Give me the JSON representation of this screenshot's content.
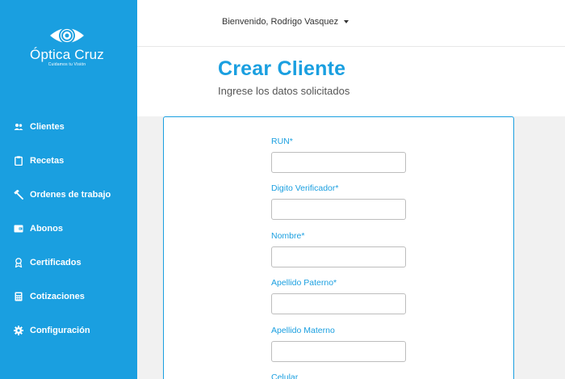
{
  "brand": {
    "name": "Óptica Cruz",
    "tagline": "Cuidamos tu Visión"
  },
  "sidebar": {
    "items": [
      {
        "label": "Clientes",
        "icon": "users-icon"
      },
      {
        "label": "Recetas",
        "icon": "clipboard-icon"
      },
      {
        "label": "Ordenes de trabajo",
        "icon": "hammer-icon"
      },
      {
        "label": "Abonos",
        "icon": "wallet-icon"
      },
      {
        "label": "Certificados",
        "icon": "award-icon"
      },
      {
        "label": "Cotizaciones",
        "icon": "calculator-icon"
      },
      {
        "label": "Configuración",
        "icon": "gear-icon"
      }
    ]
  },
  "topbar": {
    "user_greeting": "Bienvenido, Rodrigo Vasquez"
  },
  "page": {
    "title": "Crear Cliente",
    "subtitle": "Ingrese los datos solicitados"
  },
  "form": {
    "fields": [
      {
        "label": "RUN*",
        "value": ""
      },
      {
        "label": "Digito Verificador*",
        "value": ""
      },
      {
        "label": "Nombre*",
        "value": ""
      },
      {
        "label": "Apellido Paterno*",
        "value": ""
      },
      {
        "label": "Apellido Materno",
        "value": ""
      },
      {
        "label": "Celular",
        "value": ""
      }
    ]
  },
  "colors": {
    "accent": "#1a9fe0",
    "sidebar_bg": "#1a9fe0",
    "page_bg": "#f1f1f1"
  }
}
